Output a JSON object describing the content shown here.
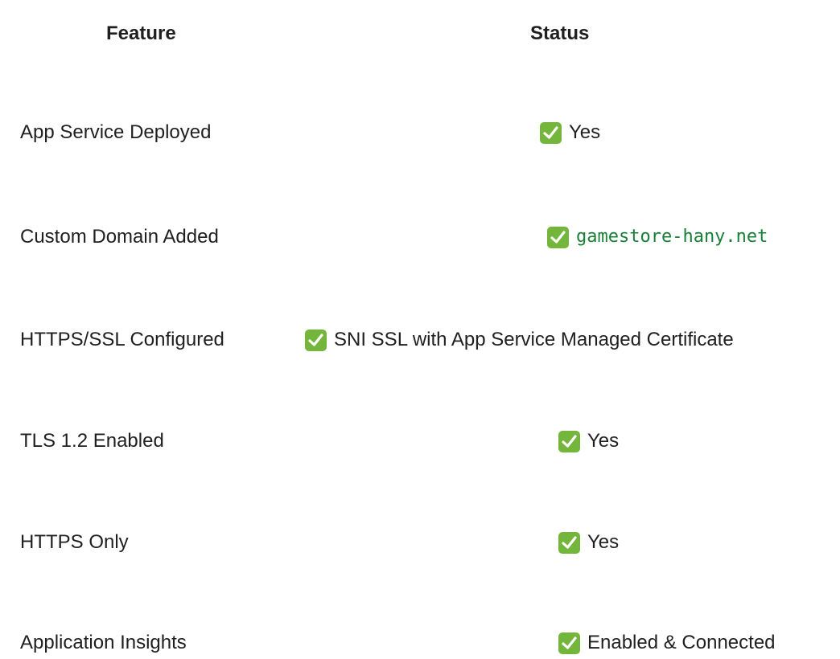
{
  "table": {
    "headers": {
      "feature": "Feature",
      "status": "Status"
    },
    "rows": [
      {
        "feature": "App Service Deployed",
        "status": "Yes",
        "status_style": "text",
        "icon": "check-mark-icon"
      },
      {
        "feature": "Custom Domain Added",
        "status": "gamestore-hany.net",
        "status_style": "code",
        "icon": "check-mark-icon"
      },
      {
        "feature": "HTTPS/SSL Configured",
        "status": "SNI SSL with App Service Managed Certificate",
        "status_style": "text",
        "icon": "check-mark-icon"
      },
      {
        "feature": "TLS 1.2 Enabled",
        "status": "Yes",
        "status_style": "text",
        "icon": "check-mark-icon"
      },
      {
        "feature": "HTTPS Only",
        "status": "Yes",
        "status_style": "text",
        "icon": "check-mark-icon"
      },
      {
        "feature": "Application Insights",
        "status": "Enabled & Connected",
        "status_style": "text",
        "icon": "check-mark-icon"
      }
    ]
  },
  "colors": {
    "text": "#1f1f1f",
    "code_text": "#188038",
    "check_bg": "#74b63c",
    "check_mark": "#ffffff"
  }
}
